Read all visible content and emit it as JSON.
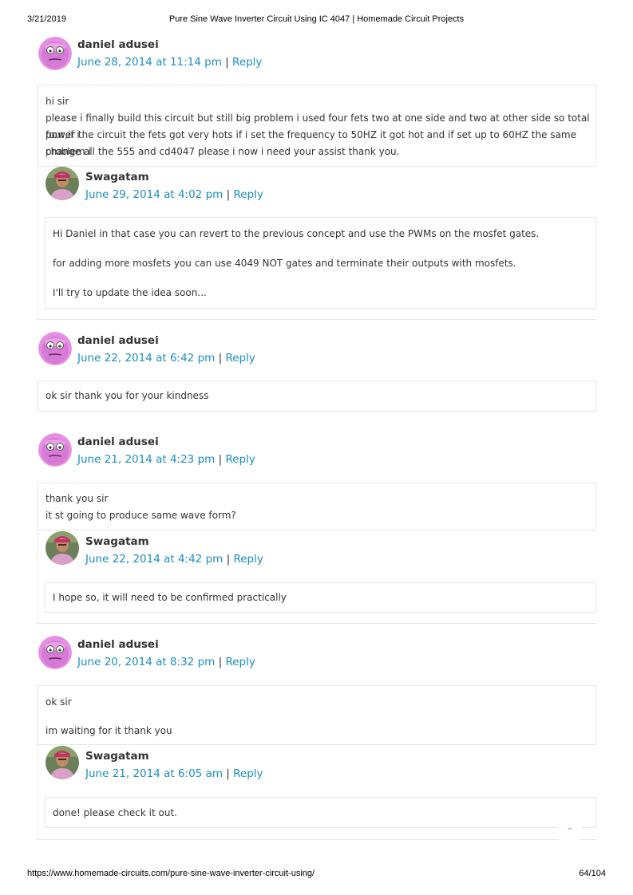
{
  "print_header": {
    "date": "3/21/2019",
    "title": "Pure Sine Wave Inverter Circuit Using IC 4047 | Homemade Circuit Projects"
  },
  "print_footer": {
    "url": "https://www.homemade-circuits.com/pure-sine-wave-inverter-circuit-using/",
    "page": "64/104"
  },
  "separator": "|",
  "reply_label": "Reply",
  "scroll_top_icon": "chevron-up-icon",
  "colors": {
    "link": "#1a8fbf",
    "border": "#e6e6e6",
    "text": "#333333"
  },
  "comments": [
    {
      "author": "daniel adusei",
      "date": "June 28, 2014 at 11:14 pm",
      "avatar_icon": "pink-smiley-avatar",
      "lines": [
        "hi sir",
        "please i finally build this circuit but still big problem i used four fets two at one side and two at other side so total four,if i",
        "power the circuit the fets got very hots if i set the frequency to 50HZ it got hot and if set up to 60HZ the same problem i",
        "change all the 555 and cd4047 please i now i need your assist thank you."
      ],
      "reply": {
        "author": "Swagatam",
        "date": "June 29, 2014 at 4:02 pm",
        "avatar_icon": "swagatam-photo-avatar",
        "lines": [
          "Hi Daniel in that case you can revert to the previous concept and use the PWMs on the mosfet gates.",
          "for adding more mosfets you can use 4049 NOT gates and terminate their outputs with mosfets.",
          "I'll try to update the idea soon..."
        ]
      }
    },
    {
      "author": "daniel adusei",
      "date": "June 22, 2014 at 6:42 pm",
      "avatar_icon": "pink-smiley-avatar",
      "lines": [
        "ok sir thank you for your kindness"
      ]
    },
    {
      "author": "daniel adusei",
      "date": "June 21, 2014 at 4:23 pm",
      "avatar_icon": "pink-smiley-avatar",
      "lines": [
        "thank you sir",
        "it st going to produce same wave form?"
      ],
      "reply": {
        "author": "Swagatam",
        "date": "June 22, 2014 at 4:42 pm",
        "avatar_icon": "swagatam-photo-avatar",
        "lines": [
          "I hope so, it will need to be confirmed practically"
        ]
      }
    },
    {
      "author": "daniel adusei",
      "date": "June 20, 2014 at 8:32 pm",
      "avatar_icon": "pink-smiley-avatar",
      "lines": [
        "ok sir",
        "im waiting for it thank you"
      ],
      "reply": {
        "author": "Swagatam",
        "date": "June 21, 2014 at 6:05 am",
        "avatar_icon": "swagatam-photo-avatar",
        "lines": [
          "done! please check it out."
        ]
      }
    }
  ]
}
